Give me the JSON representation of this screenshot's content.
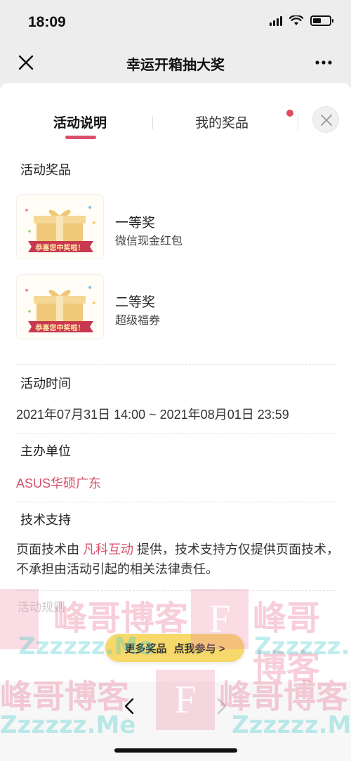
{
  "status_bar": {
    "time": "18:09"
  },
  "nav": {
    "title": "幸运开箱抽大奖",
    "close_icon": "close-icon",
    "more_icon": "more-icon"
  },
  "tabs": [
    {
      "label": "活动说明",
      "active": true
    },
    {
      "label": "我的奖品",
      "active": false,
      "has_badge": true
    }
  ],
  "sections": {
    "prizes_title": "活动奖品",
    "prizes": [
      {
        "name": "一等奖",
        "desc": "微信现金红包",
        "banner": "恭喜您中奖啦！"
      },
      {
        "name": "二等奖",
        "desc": "超级福券",
        "banner": "恭喜您中奖啦！"
      }
    ],
    "time_title": "活动时间",
    "time_value": "2021年07月31日 14:00 ~ 2021年08月01日 23:59",
    "organizer_title": "主办单位",
    "organizer_value": "ASUS华硕广东",
    "tech_title": "技术支持",
    "tech_prefix": "页面技术由 ",
    "tech_link": "凡科互动",
    "tech_suffix": " 提供，技术支持方仅提供页面技术，不承担由活动引起的相关法律责任。",
    "rules_title": "活动规则"
  },
  "cta": {
    "more_label": "更多奖品",
    "join_label": "点我参与 >"
  },
  "watermark": {
    "text": "峰哥博客",
    "sub": "Zzzzzz.Me",
    "letter": "F"
  },
  "colors": {
    "accent": "#d9506a",
    "cta": "#f6d86b",
    "background": "#ededed"
  }
}
